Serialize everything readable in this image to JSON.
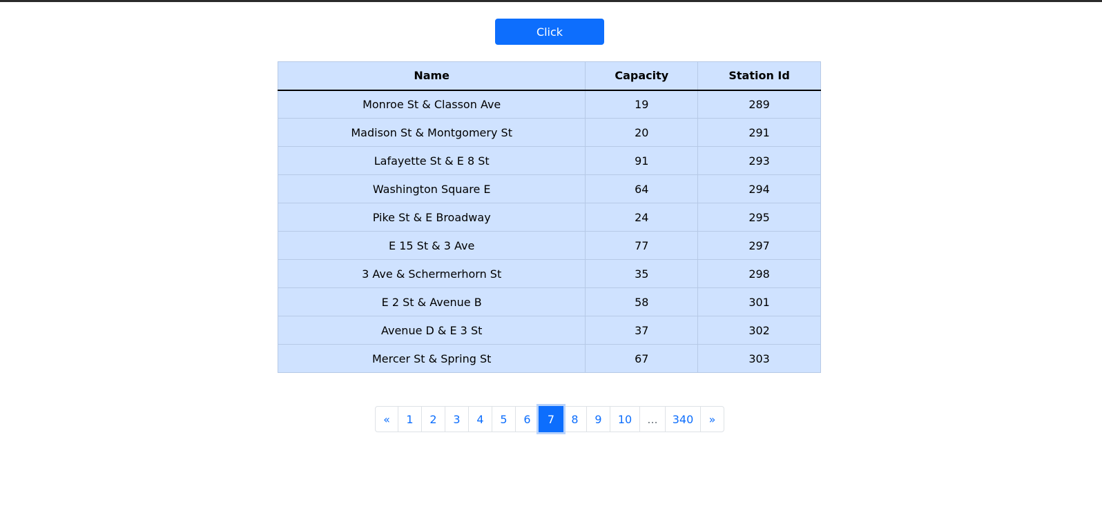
{
  "action_button": {
    "label": "Click"
  },
  "table": {
    "headers": [
      "Name",
      "Capacity",
      "Station Id"
    ],
    "rows": [
      [
        "Monroe St & Classon Ave",
        "19",
        "289"
      ],
      [
        "Madison St & Montgomery St",
        "20",
        "291"
      ],
      [
        "Lafayette St & E 8 St",
        "91",
        "293"
      ],
      [
        "Washington Square E",
        "64",
        "294"
      ],
      [
        "Pike St & E Broadway",
        "24",
        "295"
      ],
      [
        "E 15 St & 3 Ave",
        "77",
        "297"
      ],
      [
        "3 Ave & Schermerhorn St",
        "35",
        "298"
      ],
      [
        "E 2 St & Avenue B",
        "58",
        "301"
      ],
      [
        "Avenue D & E 3 St",
        "37",
        "302"
      ],
      [
        "Mercer St & Spring St",
        "67",
        "303"
      ]
    ]
  },
  "pagination": {
    "prev": "«",
    "pages": [
      "1",
      "2",
      "3",
      "4",
      "5",
      "6",
      "7",
      "8",
      "9",
      "10",
      "...",
      "340"
    ],
    "next": "»",
    "active": "7",
    "active_color": "#0d6efd"
  },
  "colors": {
    "table_background": "#cfe2ff",
    "button_primary": "#0d6efd"
  }
}
